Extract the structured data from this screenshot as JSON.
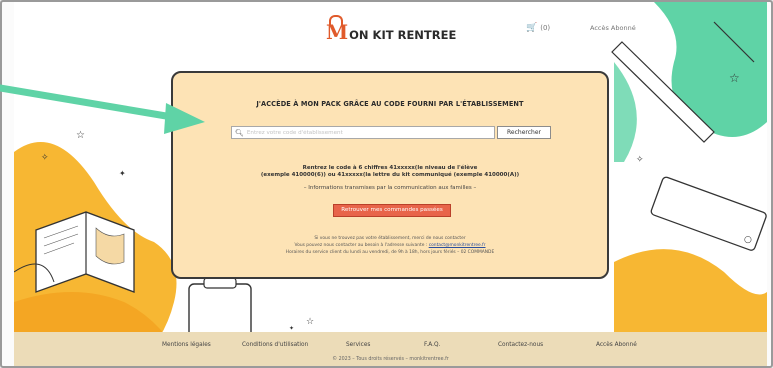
{
  "header": {
    "logo_initial": "M",
    "logo_rest": "ON KIT RENTREE",
    "cart_count": "(0)",
    "access_label": "Accès Abonné"
  },
  "panel": {
    "title": "J'ACCÈDE À MON PACK GRÂCE AU CODE FOURNI PAR L'ÉTABLISSEMENT",
    "search_placeholder": "Entrez votre code d'établissement",
    "search_button": "Rechercher",
    "instruction_line1": "Rentrez le code à 6 chiffres 41xxxxx(le niveau de l'élève",
    "instruction_line2": "(exemple 410000(6)) ou 41xxxxx(la lettre du kit communiqué (exemple 410000(A))",
    "info_line": "– Informations transmises par la communication aux familles –",
    "orders_button": "Retrouver mes commandes passées",
    "note_line1": "Si vous ne trouvez pas votre établissement, merci de nous contacter",
    "note_line2_prefix": "Vous pouvez nous contacter au besoin à l'adresse suivante : ",
    "note_line2_link": "contact@monkitrentree.fr",
    "note_line3": "Horaires du service client du lundi au vendredi, de 9h à 18h, hors jours fériés – 02 COMMANDE"
  },
  "footer": {
    "links": [
      "Mentions légales",
      "Conditions d'utilisation",
      "Services",
      "F.A.Q.",
      "Contactez-nous",
      "Accès Abonné"
    ],
    "copyright": "© 2023 – Tous droits réservés – monkitrentree.fr"
  },
  "colors": {
    "brand": "#e05a2b",
    "panel_bg": "#fde3b5",
    "orders_button": "#e8644a",
    "arrow": "#5fd3a6",
    "footer_bg": "#ecdcb8"
  }
}
